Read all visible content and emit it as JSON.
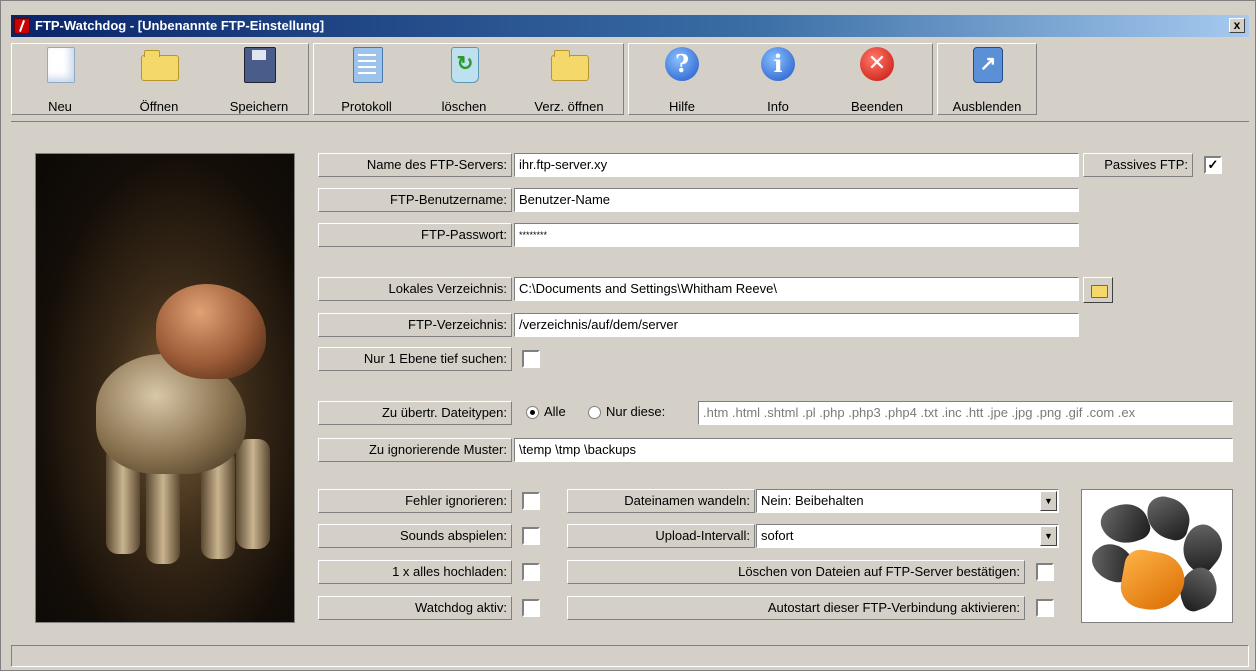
{
  "window": {
    "title": "FTP-Watchdog - [Unbenannte FTP-Einstellung]",
    "close_label": "x"
  },
  "toolbar": {
    "new": "Neu",
    "open": "Öffnen",
    "save": "Speichern",
    "log": "Protokoll",
    "delete": "löschen",
    "open_dir": "Verz. öffnen",
    "help": "Hilfe",
    "info": "Info",
    "exit": "Beenden",
    "hide": "Ausblenden",
    "icons": {
      "new": "new-document-icon",
      "open": "open-folder-icon",
      "save": "floppy-disk-icon",
      "log": "notepad-icon",
      "delete": "recycle-bin-icon",
      "open_dir": "folder-icon",
      "help": "help-icon",
      "info": "info-icon",
      "exit": "exit-icon",
      "hide": "hide-window-icon"
    },
    "glyphs": {
      "help": "?",
      "info": "i",
      "exit": "✕",
      "hide": "↗",
      "delete": "↻"
    }
  },
  "form": {
    "server_label": "Name des FTP-Servers:",
    "server_value": "ihr.ftp-server.xy",
    "passive_label": "Passives FTP:",
    "passive_checked": true,
    "user_label": "FTP-Benutzername:",
    "user_value": "Benutzer-Name",
    "password_label": "FTP-Passwort:",
    "password_value": "********",
    "local_dir_label": "Lokales Verzeichnis:",
    "local_dir_value": "C:\\Documents and Settings\\Whitham Reeve\\",
    "ftp_dir_label": "FTP-Verzeichnis:",
    "ftp_dir_value": "/verzeichnis/auf/dem/server",
    "one_level_label": "Nur 1 Ebene tief suchen:",
    "one_level_checked": false,
    "filetypes_label": "Zu übertr. Dateitypen:",
    "filetypes_all": "Alle",
    "filetypes_only": "Nur diese:",
    "filetypes_selected": "Alle",
    "filetypes_value": ".htm .html .shtml .pl .php .php3 .php4 .txt .inc .htt .jpe .jpg .png .gif .com .ex",
    "ignore_label": "Zu ignorierende Muster:",
    "ignore_value": "\\temp \\tmp \\backups",
    "ignore_errors_label": "Fehler ignorieren:",
    "sounds_label": "Sounds abspielen:",
    "upload_all_label": "1 x alles hochladen:",
    "watchdog_label": "Watchdog aktiv:",
    "rename_label": "Dateinamen wandeln:",
    "rename_value": "Nein: Beibehalten",
    "interval_label": "Upload-Intervall:",
    "interval_value": "sofort",
    "confirm_delete_label": "Löschen von Dateien auf FTP-Server bestätigen:",
    "autostart_label": "Autostart dieser FTP-Verbindung aktivieren:",
    "check_mark": "✓",
    "combo_arrow": "▼"
  }
}
